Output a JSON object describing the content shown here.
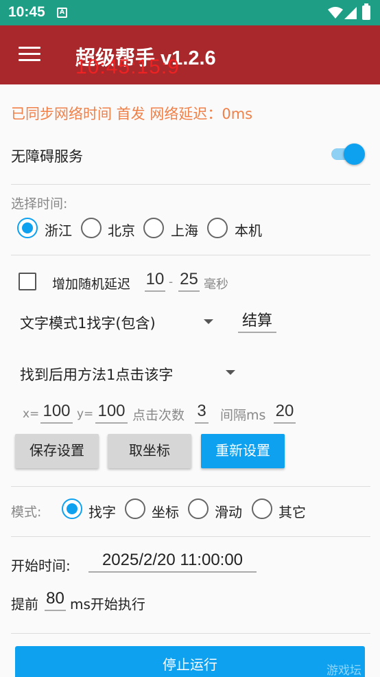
{
  "status_bar": {
    "time": "10:45",
    "notification_glyph": "A"
  },
  "appbar": {
    "title": "超级帮手 v1.2.6",
    "clock": "10:45:15:9"
  },
  "sync_status": "已同步网络时间 首发 网络延迟：0ms",
  "accessibility": {
    "label": "无障碍服务",
    "enabled": true
  },
  "time_select": {
    "label": "选择时间:",
    "options": [
      "浙江",
      "北京",
      "上海",
      "本机"
    ],
    "selected": "浙江"
  },
  "random_delay": {
    "label": "增加随机延迟",
    "min": "10",
    "separator": "-",
    "max": "25",
    "unit": "毫秒"
  },
  "text_mode": {
    "selected": "文字模式1找字(包含)",
    "keyword": "结算"
  },
  "click_method": {
    "selected": "找到后用方法1点击该字"
  },
  "coords": {
    "x_label": "x=",
    "x": "100",
    "y_label": "y=",
    "y": "100",
    "count_label": "点击次数",
    "count": "3",
    "interval_label": "间隔ms",
    "interval": "20"
  },
  "buttons": {
    "save": "保存设置",
    "pick_coord": "取坐标",
    "reset": "重新设置"
  },
  "mode": {
    "label": "模式:",
    "options": [
      "找字",
      "坐标",
      "滑动",
      "其它"
    ],
    "selected": "找字"
  },
  "start_time": {
    "label": "开始时间:",
    "value": "2025/2/20 11:00:00"
  },
  "advance": {
    "prefix": "提前",
    "value": "80",
    "suffix": "ms开始执行"
  },
  "run_button": "停止运行",
  "watermark": "游戏坛",
  "colors": {
    "accent": "#0ea1f0",
    "appbar": "#a8282b",
    "statusbar": "#1f9e86",
    "sync_text": "#f08048",
    "clock_text": "#ee2222"
  }
}
